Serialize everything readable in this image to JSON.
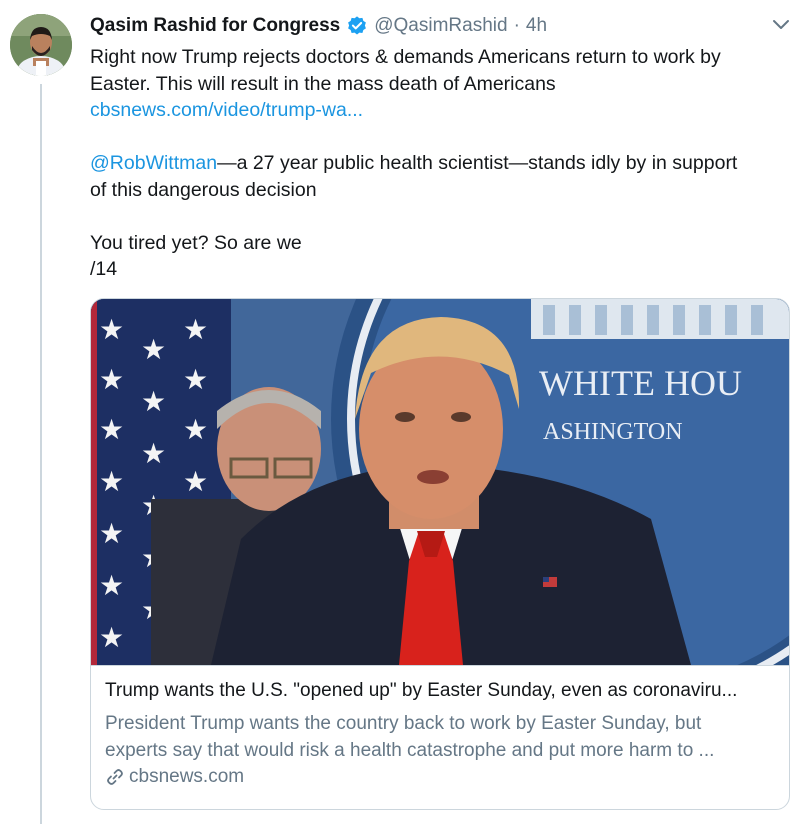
{
  "tweet": {
    "author_name": "Qasim Rashid for Congress",
    "handle": "@QasimRashid",
    "separator": "·",
    "time": "4h",
    "text_line_1": "Right now Trump rejects doctors & demands Americans return to work by",
    "text_line_2": "Easter. This will result in the mass death of Americans",
    "link_url": "cbsnews.com/video/trump-wa...",
    "mention": "@RobWittman",
    "mention_rest": "—a 27 year public health scientist—stands idly by in support",
    "text_line_5": "of this dangerous decision",
    "text_line_6": "You tired yet? So are we",
    "text_line_7": "/14"
  },
  "card": {
    "image_text_1": "WHITE HOU",
    "image_text_2": "ASHINGTON",
    "title": "Trump wants the U.S. \"opened up\" by Easter Sunday, even as coronaviru...",
    "description_line_1": "President Trump wants the country back to work by Easter Sunday, but",
    "description_line_2": "experts say that would risk a health catastrophe and put more harm to ...",
    "domain": "cbsnews.com"
  },
  "colors": {
    "link": "#1b95e0",
    "secondary_text": "#657786",
    "verified_badge": "#1da1f2",
    "tie": "#d8221c"
  },
  "icons": {
    "verified": "verified-badge-icon",
    "caret": "chevron-down-icon",
    "link": "link-icon"
  }
}
